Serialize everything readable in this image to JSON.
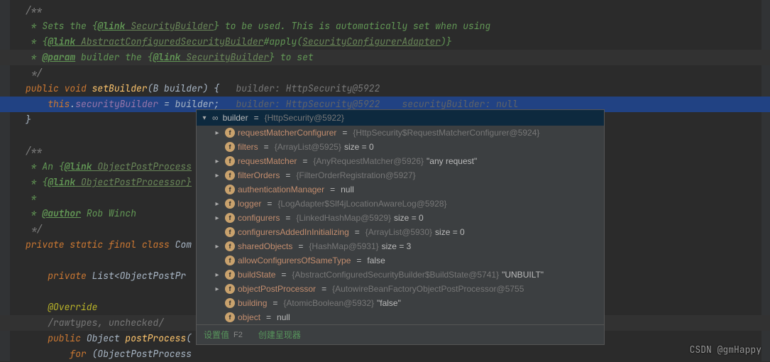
{
  "code": {
    "l1": "/**",
    "l2a": " * Sets the {",
    "l2link": "@link",
    "l2b": " SecurityBuilder",
    "l2c": "} to be used. This is automatically set when using",
    "l3a": " * {",
    "l3link": "@link",
    "l3b": " AbstractConfiguredSecurityBuilder",
    "l3c": "#apply(",
    "l3d": "SecurityConfigurerAdapter",
    "l3e": ")}",
    "l4a": " * ",
    "l4tag": "@param",
    "l4b": " builder",
    "l4c": " the {",
    "l4link": "@link",
    "l4d": " SecurityBuilder",
    "l4e": "} to set",
    "l5": " */",
    "l6a": "public",
    "l6b": " void ",
    "l6c": "setBuilder",
    "l6d": "(B builder) {   ",
    "l6hint": "builder: HttpSecurity@5922",
    "l7a": "this",
    "l7b": ".",
    "l7c": "securityBuilder",
    "l7d": " = ",
    "l7e": "builder",
    "l7f": ";   ",
    "l7hint1": "builder: HttpSecurity@5922",
    "l7hint2": "    securityBuilder: null",
    "l8": "}",
    "l9": "",
    "l10": "/**",
    "l11a": " * An {",
    "l11link": "@link",
    "l11b": " ObjectPostProcess",
    "l12a": " * {",
    "l12link": "@link",
    "l12b": " ObjectPostProcessor}",
    "l13": " *",
    "l14a": " * ",
    "l14tag": "@author",
    "l14b": " Rob Winch",
    "l15": " */",
    "l16a": "private",
    "l16b": " static ",
    "l16c": "final",
    "l16d": " class ",
    "l16e": "Com",
    "l17": "",
    "l18a": "private ",
    "l18b": "List<ObjectPostPr",
    "l19": "",
    "l20": "@Override",
    "l21": "/rawtypes, unchecked/",
    "l22a": "public ",
    "l22b": "Object ",
    "l22c": "postProcess",
    "l22d": "(",
    "l23a": "for ",
    "l23b": "(ObjectPostProcess"
  },
  "popup": {
    "headerName": "builder",
    "headerVal": "{HttpSecurity@5922}",
    "rows": [
      {
        "exp": ">",
        "lock": true,
        "name": "requestMatcherConfigurer",
        "val": "{HttpSecurity$RequestMatcherConfigurer@5924}",
        "extra": ""
      },
      {
        "exp": "",
        "lock": false,
        "name": "filters",
        "val": "{ArrayList@5925}",
        "extra": " size = 0"
      },
      {
        "exp": ">",
        "lock": true,
        "name": "requestMatcher",
        "val": "{AnyRequestMatcher@5926}",
        "extra": " \"any request\""
      },
      {
        "exp": ">",
        "lock": false,
        "name": "filterOrders",
        "val": "{FilterOrderRegistration@5927}",
        "extra": ""
      },
      {
        "exp": "",
        "lock": false,
        "name": "authenticationManager",
        "val": "null",
        "extra": "",
        "plain": true
      },
      {
        "exp": ">",
        "lock": true,
        "name": "logger",
        "val": "{LogAdapter$Slf4jLocationAwareLog@5928}",
        "extra": ""
      },
      {
        "exp": ">",
        "lock": true,
        "name": "configurers",
        "val": "{LinkedHashMap@5929}",
        "extra": " size = 0"
      },
      {
        "exp": "",
        "lock": true,
        "name": "configurersAddedInInitializing",
        "val": "{ArrayList@5930}",
        "extra": " size = 0"
      },
      {
        "exp": ">",
        "lock": true,
        "name": "sharedObjects",
        "val": "{HashMap@5931}",
        "extra": " size = 3"
      },
      {
        "exp": "",
        "lock": true,
        "name": "allowConfigurersOfSameType",
        "val": "false",
        "extra": "",
        "plain": true
      },
      {
        "exp": ">",
        "lock": false,
        "name": "buildState",
        "val": "{AbstractConfiguredSecurityBuilder$BuildState@5741}",
        "extra": " \"UNBUILT\""
      },
      {
        "exp": ">",
        "lock": false,
        "name": "objectPostProcessor",
        "val": "{AutowireBeanFactoryObjectPostProcessor@5755",
        "extra": ""
      },
      {
        "exp": "",
        "lock": false,
        "name": "building",
        "val": "{AtomicBoolean@5932}",
        "extra": " \"false\""
      },
      {
        "exp": "",
        "lock": false,
        "name": "object",
        "val": "null",
        "extra": "",
        "plain": true
      }
    ],
    "footer": {
      "setValue": "设置值",
      "key": "F2",
      "renderer": "创建呈现器"
    }
  },
  "watermark": "CSDN @gmHappy"
}
